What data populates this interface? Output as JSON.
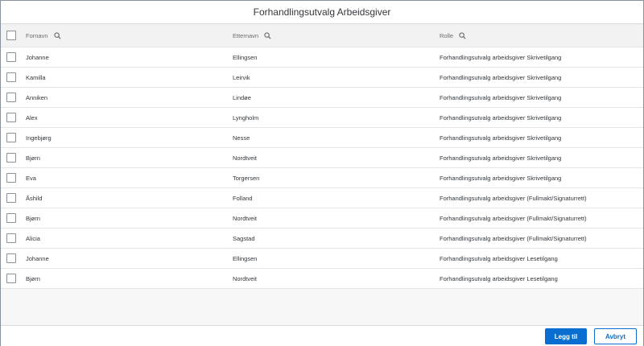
{
  "dialog": {
    "title": "Forhandlingsutvalg Arbeidsgiver"
  },
  "table": {
    "columns": [
      {
        "label": "Fornavn",
        "icon": "search-icon"
      },
      {
        "label": "Etternavn",
        "icon": "search-icon"
      },
      {
        "label": "Rolle",
        "icon": "search-icon"
      }
    ],
    "rows": [
      {
        "first": "Johanne",
        "last": "Ellingsen",
        "role": "Forhandlingsutvalg arbeidsgiver Skrivetilgang"
      },
      {
        "first": "Kamilla",
        "last": "Leirvik",
        "role": "Forhandlingsutvalg arbeidsgiver Skrivetilgang"
      },
      {
        "first": "Anniken",
        "last": "Lindøe",
        "role": "Forhandlingsutvalg arbeidsgiver Skrivetilgang"
      },
      {
        "first": "Alex",
        "last": "Lyngholm",
        "role": "Forhandlingsutvalg arbeidsgiver Skrivetilgang"
      },
      {
        "first": "Ingebjørg",
        "last": "Nesse",
        "role": "Forhandlingsutvalg arbeidsgiver Skrivetilgang"
      },
      {
        "first": "Bjørn",
        "last": "Nordtveit",
        "role": "Forhandlingsutvalg arbeidsgiver Skrivetilgang"
      },
      {
        "first": "Eva",
        "last": "Torgersen",
        "role": "Forhandlingsutvalg arbeidsgiver Skrivetilgang"
      },
      {
        "first": "Åshild",
        "last": "Folland",
        "role": "Forhandlingsutvalg arbeidsgiver (Fullmakt/Signaturrett)"
      },
      {
        "first": "Bjørn",
        "last": "Nordtveit",
        "role": "Forhandlingsutvalg arbeidsgiver (Fullmakt/Signaturrett)"
      },
      {
        "first": "Alicia",
        "last": "Sagstad",
        "role": "Forhandlingsutvalg arbeidsgiver (Fullmakt/Signaturrett)"
      },
      {
        "first": "Johanne",
        "last": "Ellingsen",
        "role": "Forhandlingsutvalg arbeidsgiver Lesetilgang"
      },
      {
        "first": "Bjørn",
        "last": "Nordtveit",
        "role": "Forhandlingsutvalg arbeidsgiver Lesetilgang"
      }
    ]
  },
  "footer": {
    "primary_label": "Legg til",
    "secondary_label": "Avbryt"
  },
  "colors": {
    "accent": "#0a6ed1",
    "text": "#32363a",
    "header_bg": "#f2f2f2"
  }
}
